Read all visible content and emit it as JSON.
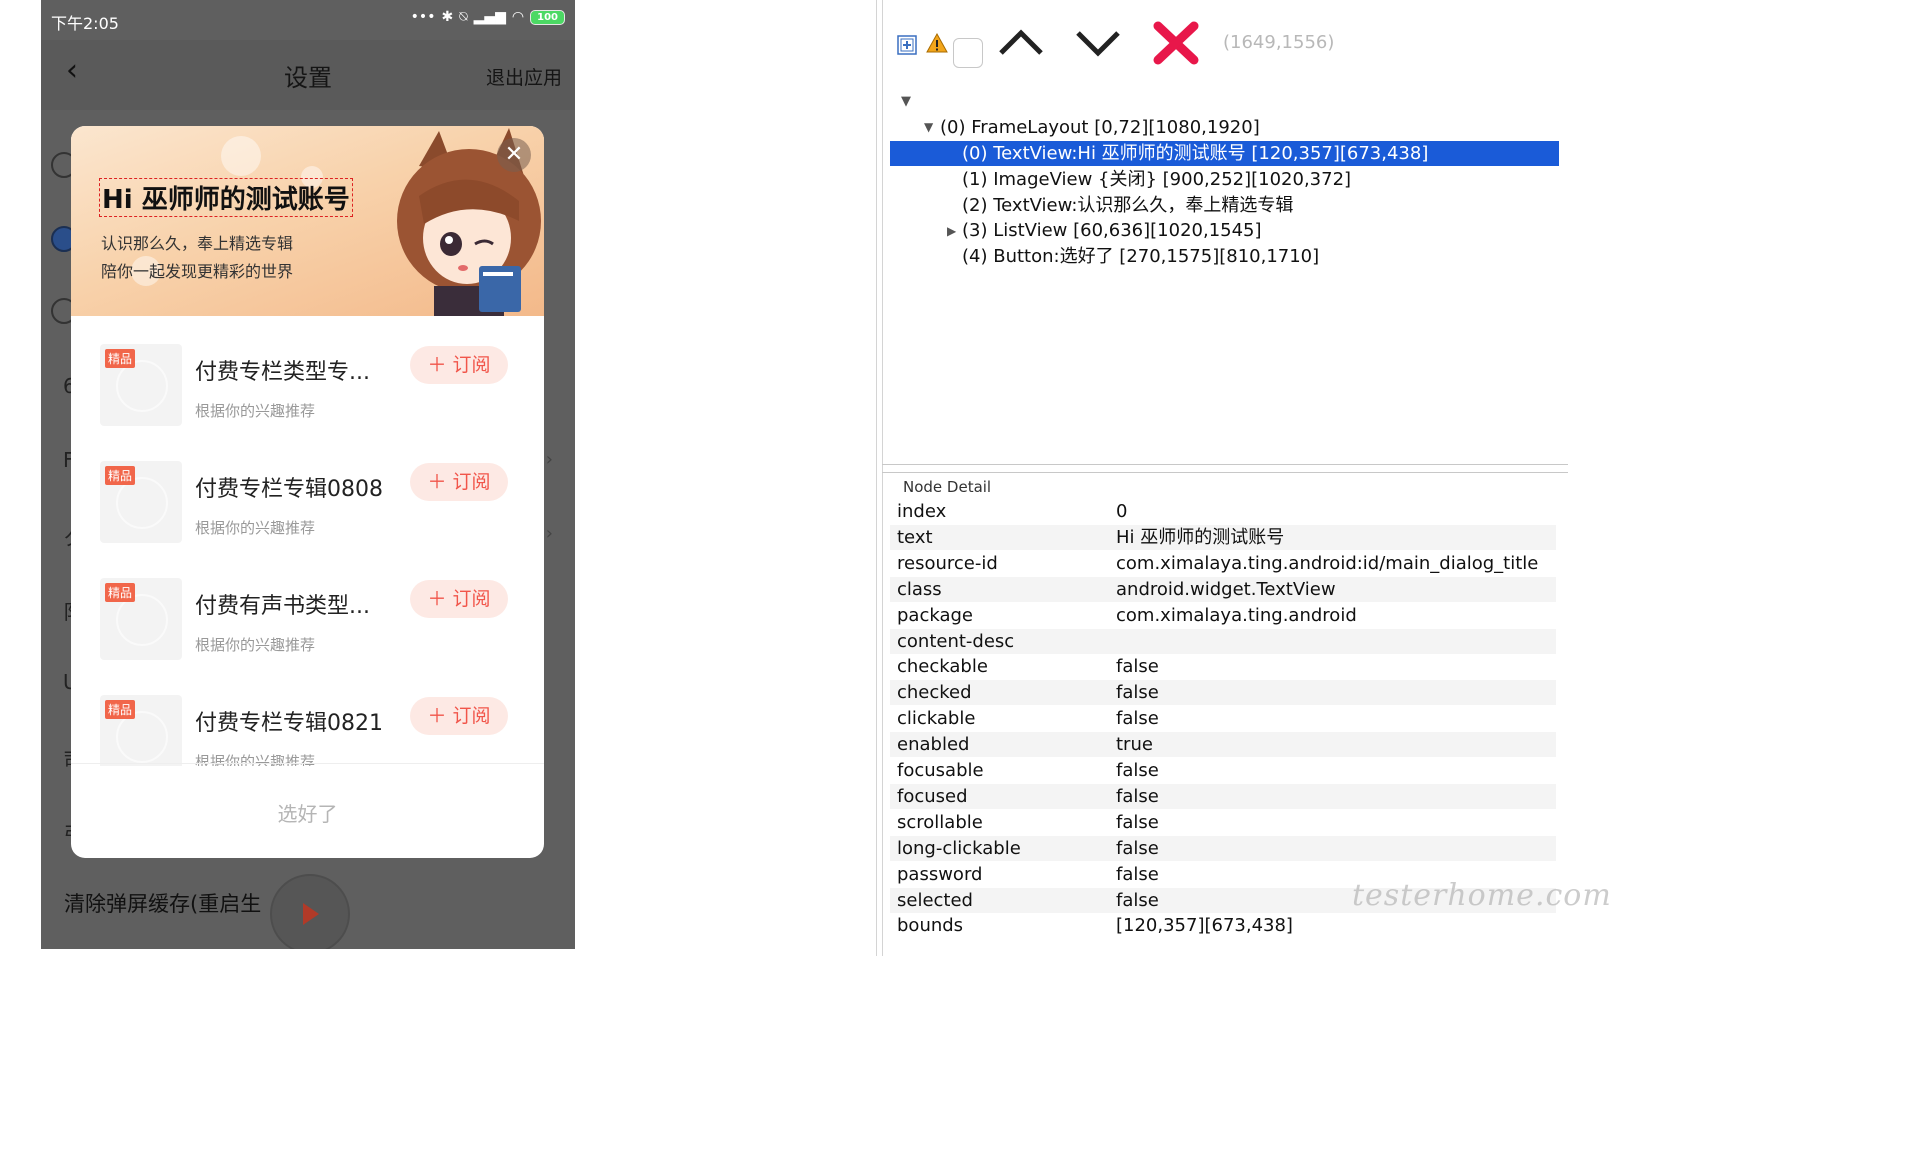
{
  "phone": {
    "status": {
      "time": "下午2:05",
      "battery": "100"
    },
    "nav": {
      "title": "设置",
      "exit": "退出应用"
    },
    "bg_letters": [
      "6",
      "F",
      "ク",
      "阝",
      "U",
      "司",
      "弓"
    ],
    "clear_cache": "清除弹屏缓存(重启生"
  },
  "dialog": {
    "title": "Hi 巫师师的测试账号",
    "subtitle_1": "认识那么久，奉上精选专辑",
    "subtitle_2": "陪你一起发现更精彩的世界",
    "badge": "精品",
    "subscribe_label": "订阅",
    "items": [
      {
        "title": "付费专栏类型专...",
        "sub": "根据你的兴趣推荐"
      },
      {
        "title": "付费专栏专辑0808",
        "sub": "根据你的兴趣推荐"
      },
      {
        "title": "付费有声书类型...",
        "sub": "根据你的兴趣推荐"
      },
      {
        "title": "付费专栏专辑0821",
        "sub": "根据你的兴趣推荐"
      }
    ],
    "done_label": "选好了"
  },
  "inspector": {
    "coords": "(1649,1556)",
    "tree": {
      "root": "(0) FrameLayout [0,72][1080,1920]",
      "children": [
        "(0) TextView:Hi 巫师师的测试账号 [120,357][673,438]",
        "(1) ImageView {关闭} [900,252][1020,372]",
        "(2) TextView:认识那么久，奉上精选专辑",
        "(3) ListView [60,636][1020,1545]",
        "(4) Button:选好了 [270,1575][810,1710]"
      ]
    },
    "node_detail_title": "Node Detail",
    "details": [
      {
        "k": "index",
        "v": "0"
      },
      {
        "k": "text",
        "v": "Hi 巫师师的测试账号"
      },
      {
        "k": "resource-id",
        "v": "com.ximalaya.ting.android:id/main_dialog_title"
      },
      {
        "k": "class",
        "v": "android.widget.TextView"
      },
      {
        "k": "package",
        "v": "com.ximalaya.ting.android"
      },
      {
        "k": "content-desc",
        "v": ""
      },
      {
        "k": "checkable",
        "v": "false"
      },
      {
        "k": "checked",
        "v": "false"
      },
      {
        "k": "clickable",
        "v": "false"
      },
      {
        "k": "enabled",
        "v": "true"
      },
      {
        "k": "focusable",
        "v": "false"
      },
      {
        "k": "focused",
        "v": "false"
      },
      {
        "k": "scrollable",
        "v": "false"
      },
      {
        "k": "long-clickable",
        "v": "false"
      },
      {
        "k": "password",
        "v": "false"
      },
      {
        "k": "selected",
        "v": "false"
      },
      {
        "k": "bounds",
        "v": "[120,357][673,438]"
      }
    ],
    "watermark": "testerhome.com"
  },
  "colors": {
    "accent": "#f1554a",
    "selection": "#1a5bd8",
    "close_x": "#e8174a"
  }
}
